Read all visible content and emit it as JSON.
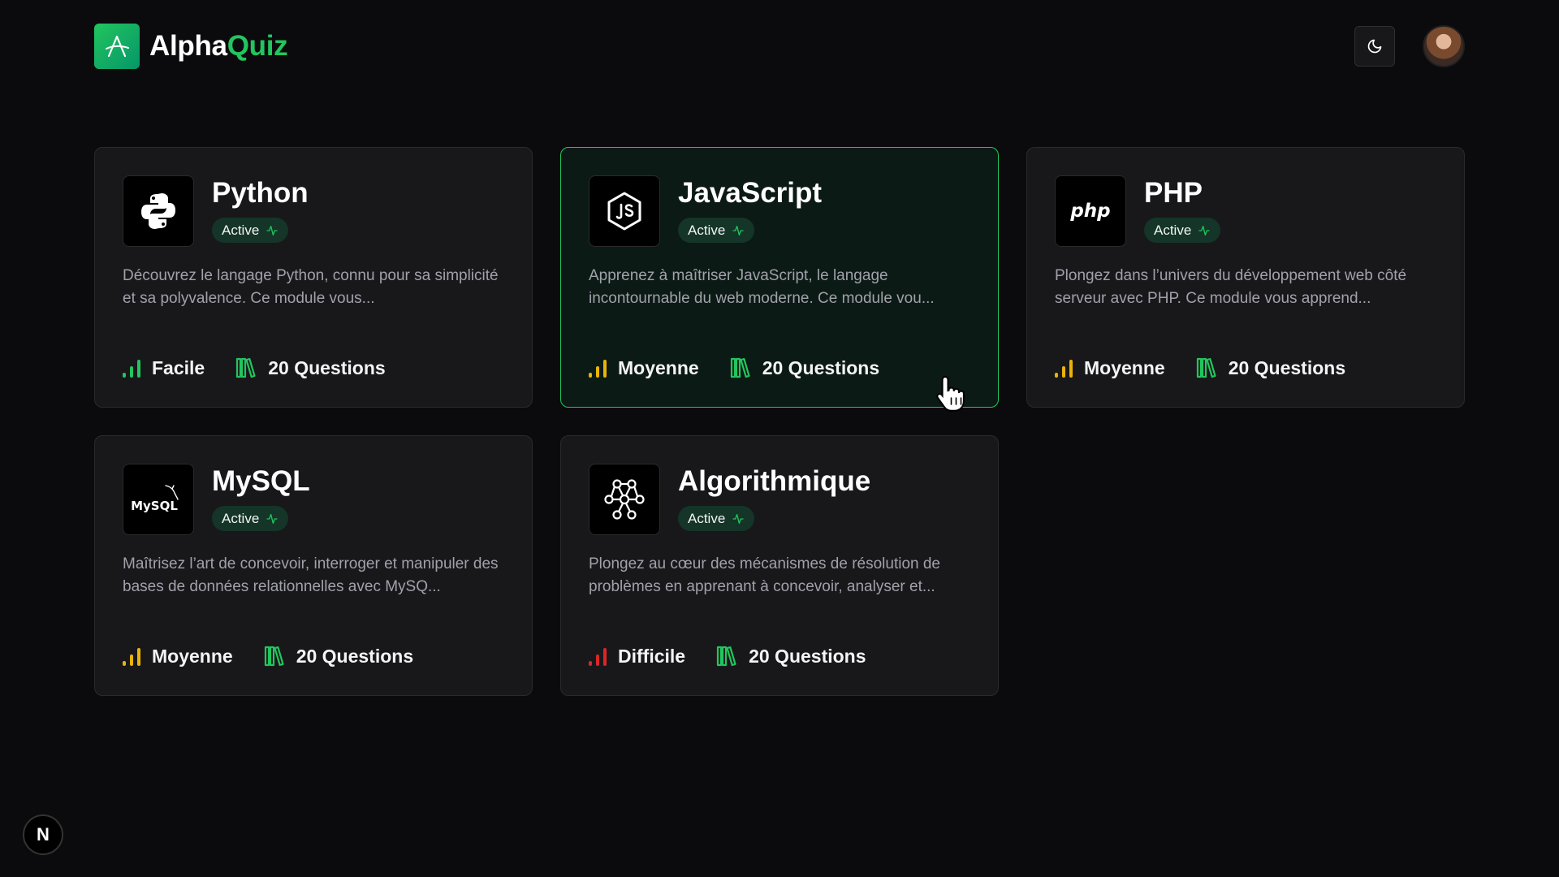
{
  "brand": {
    "part1": "Alpha",
    "part2": "Quiz",
    "logo_icon": "alpha-logo-icon"
  },
  "header": {
    "theme_toggle_icon": "moon-icon",
    "avatar": "user-avatar"
  },
  "colors": {
    "accent": "#22c55e",
    "badge_bg": "#143528",
    "easy": "#22c55e",
    "medium": "#eab308",
    "hard": "#dc2626"
  },
  "cards": [
    {
      "title": "Python",
      "status": "Active",
      "description": "Découvrez le langage Python, connu pour sa simplicité et sa polyvalence. Ce module vous...",
      "difficulty": "Facile",
      "difficulty_level": "easy",
      "questions": "20 Questions",
      "icon": "python-icon"
    },
    {
      "title": "JavaScript",
      "status": "Active",
      "description": "Apprenez à maîtriser JavaScript, le langage incontournable du web moderne. Ce module vou...",
      "difficulty": "Moyenne",
      "difficulty_level": "medium",
      "questions": "20 Questions",
      "icon": "javascript-icon"
    },
    {
      "title": "PHP",
      "status": "Active",
      "description": "Plongez dans l’univers du développement web côté serveur avec PHP. Ce module vous apprend...",
      "difficulty": "Moyenne",
      "difficulty_level": "medium",
      "questions": "20 Questions",
      "icon": "php-icon",
      "icon_text": "php"
    },
    {
      "title": "MySQL",
      "status": "Active",
      "description": "Maîtrisez l’art de concevoir, interroger et manipuler des bases de données relationnelles avec MySQ...",
      "difficulty": "Moyenne",
      "difficulty_level": "medium",
      "questions": "20 Questions",
      "icon": "mysql-icon",
      "icon_text": "MySQL"
    },
    {
      "title": "Algorithmique",
      "status": "Active",
      "description": "Plongez au cœur des mécanismes de résolution de problèmes en apprenant à concevoir, analyser et...",
      "difficulty": "Difficile",
      "difficulty_level": "hard",
      "questions": "20 Questions",
      "icon": "network-nodes-icon"
    }
  ],
  "dev_badge": {
    "label": "N"
  }
}
